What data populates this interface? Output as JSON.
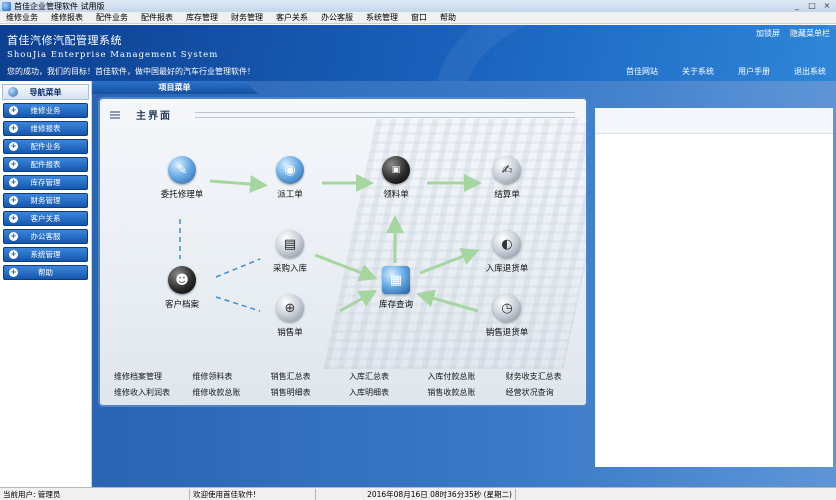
{
  "window": {
    "title": "首佳企业管理软件 试用版",
    "controls": [
      "_",
      "□",
      "×"
    ]
  },
  "menubar": [
    "维修业务",
    "维修报表",
    "配件业务",
    "配件报表",
    "库存管理",
    "财务管理",
    "客户关系",
    "办公客服",
    "系统管理",
    "窗口",
    "帮助"
  ],
  "header": {
    "title": "首佳汽修汽配管理系统",
    "subtitle": "ShouJia Enterprise Management System",
    "slogan": "您的成功，我们的目标！首佳软件，做中国最好的汽车行业管理软件！",
    "top_links": [
      "加锁屏",
      "隐藏菜单栏"
    ],
    "nav_links": [
      "首佳网站",
      "关于系统",
      "用户手册",
      "退出系统"
    ]
  },
  "sidebar": {
    "title": "导航菜单",
    "items": [
      "维修业务",
      "维修报表",
      "配件业务",
      "配件报表",
      "库存管理",
      "财务管理",
      "客户关系",
      "办公客服",
      "系统管理",
      "帮助"
    ]
  },
  "main": {
    "tab_label": "项目菜单",
    "panel_title": "主界面",
    "nodes": {
      "entrust": "委托修理单",
      "dispatch": "派工单",
      "picking": "领料单",
      "settlement": "结算单",
      "purchase_in": "采购入库",
      "return_in": "入库退货单",
      "customer": "客户档案",
      "stock_query": "库存查询",
      "sales": "销售单",
      "sales_return": "销售退货单"
    },
    "links_row1": [
      "维修档案管理",
      "维修领料表",
      "销售汇总表",
      "入库汇总表",
      "入库付款总账",
      "财务收支汇总表"
    ],
    "links_row2": [
      "维修收入利润表",
      "维修收款总账",
      "销售明细表",
      "入库明细表",
      "销售收款总账",
      "经营状况查询"
    ]
  },
  "status": {
    "user": "当前用户: 管理员",
    "welcome": "欢迎使用首佳软件!",
    "datetime": "2016年08月16日  08时36分35秒  (星期二)"
  },
  "colors": {
    "header_blue": "#1a62bd",
    "nav_button": "#1557ad",
    "flow_arrow": "#a6d6a0",
    "dash_line": "#3a8fd8"
  }
}
